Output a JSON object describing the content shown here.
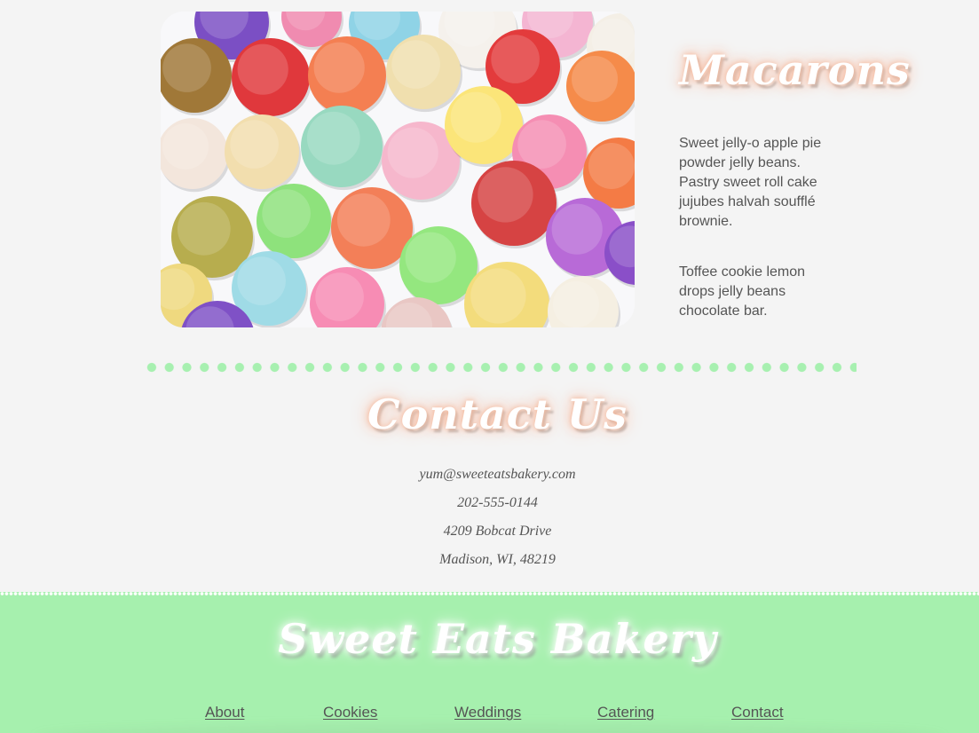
{
  "feature": {
    "image_alt": "macaron-photo",
    "title": "Macarons",
    "paragraph1": "Sweet jelly-o apple pie powder jelly beans. Pastry sweet roll cake jujubes halvah soufflé brownie.",
    "paragraph2": "Toffee cookie lemon drops jelly beans chocolate bar."
  },
  "contact": {
    "title": "Contact Us",
    "email": "yum@sweeteatsbakery.com",
    "phone": "202-555-0144",
    "street": "4209 Bobcat Drive",
    "city": "Madison, WI, 48219"
  },
  "footer": {
    "brand": "Sweet Eats Bakery",
    "nav": [
      "About",
      "Cookies",
      "Weddings",
      "Catering",
      "Contact"
    ]
  },
  "colors": {
    "background": "#f4f4f4",
    "accent_green": "#a6f0ae",
    "glow_peach": "#f7c3ad",
    "text_gray": "#555555"
  }
}
